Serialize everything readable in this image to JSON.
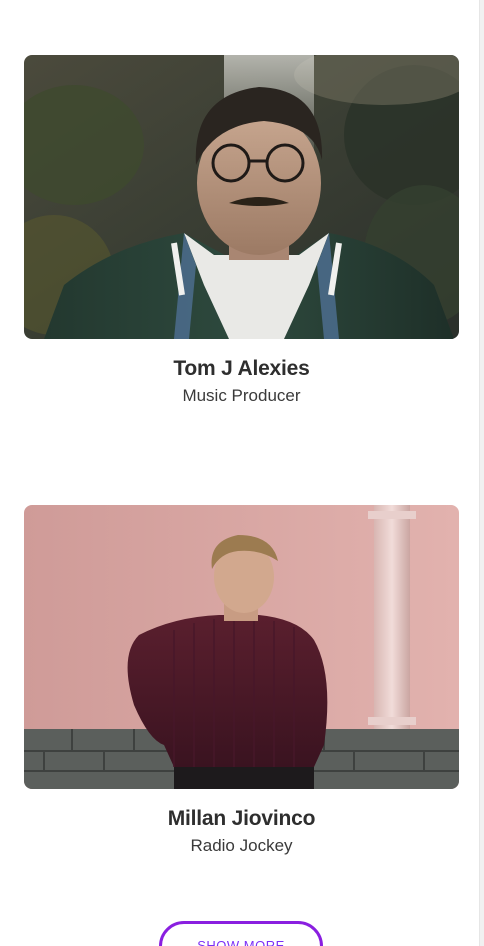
{
  "profiles": [
    {
      "name": "Tom J Alexies",
      "role": "Music Producer"
    },
    {
      "name": "Millan Jiovinco",
      "role": "Radio Jockey"
    }
  ],
  "actions": {
    "show_more_label": "SHOW MORE"
  },
  "colors": {
    "accent_border": "#8a1fe0",
    "accent_text": "#7b2ff7"
  }
}
